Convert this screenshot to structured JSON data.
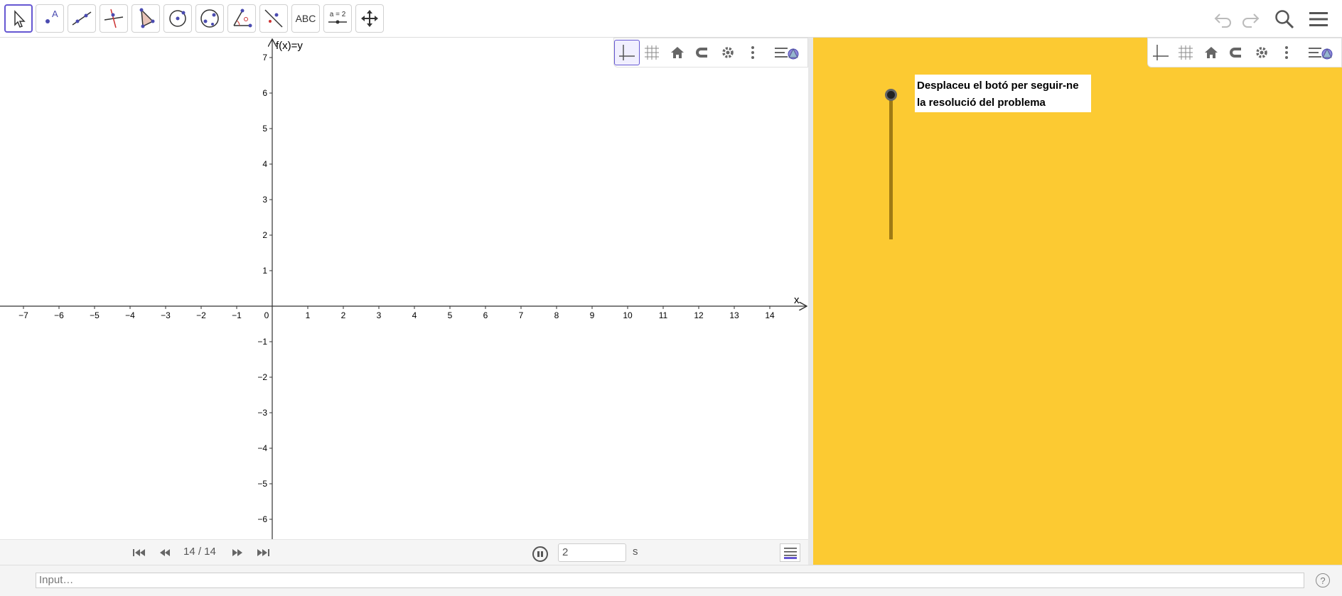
{
  "toolbar": {
    "tools": [
      {
        "name": "move-tool",
        "label": ""
      },
      {
        "name": "point-tool",
        "label": "A"
      },
      {
        "name": "line-tool",
        "label": ""
      },
      {
        "name": "perpendicular-line-tool",
        "label": ""
      },
      {
        "name": "polygon-tool",
        "label": ""
      },
      {
        "name": "circle-tool",
        "label": ""
      },
      {
        "name": "ellipse-tool",
        "label": ""
      },
      {
        "name": "angle-tool",
        "label": ""
      },
      {
        "name": "reflect-tool",
        "label": ""
      },
      {
        "name": "text-tool",
        "label": "ABC"
      },
      {
        "name": "slider-tool",
        "label": "a = 2"
      },
      {
        "name": "move-graphics-view-tool",
        "label": ""
      }
    ],
    "right_icons": [
      "undo-icon",
      "redo-icon",
      "search-icon",
      "menu-icon"
    ]
  },
  "graphics1": {
    "y_axis_label": "f(x)=y",
    "x_axis_label": "x",
    "x_ticks": [
      "−7",
      "−6",
      "−5",
      "−4",
      "−3",
      "−2",
      "−1",
      "0",
      "1",
      "2",
      "3",
      "4",
      "5",
      "6",
      "7",
      "8",
      "9",
      "10",
      "11",
      "12",
      "13",
      "14"
    ],
    "y_ticks_pos": [
      "1",
      "2",
      "3",
      "4",
      "5",
      "6",
      "7"
    ],
    "y_ticks_neg": [
      "−1",
      "−2",
      "−3",
      "−4",
      "−5",
      "−6"
    ],
    "stylebar_icons": [
      "axes-icon",
      "grid-icon",
      "home-icon",
      "snap-icon",
      "gear-icon",
      "more-vert-icon",
      "style-menu-icon"
    ]
  },
  "graphics2": {
    "background_color": "#fcca32",
    "note_line1": "Desplaceu el botó per seguir-ne",
    "note_line2": "la resolució del problema",
    "stylebar_icons": [
      "axes-icon",
      "grid-icon",
      "home-icon",
      "snap-icon",
      "gear-icon",
      "more-vert-icon",
      "style-menu-icon"
    ]
  },
  "playback": {
    "counter": "14 / 14",
    "speed_value": "2",
    "speed_unit": "s"
  },
  "inputbar": {
    "placeholder": "Input…",
    "help_label": "?"
  },
  "colors": {
    "accent": "#6557d2",
    "panel_yellow": "#fcca32"
  }
}
